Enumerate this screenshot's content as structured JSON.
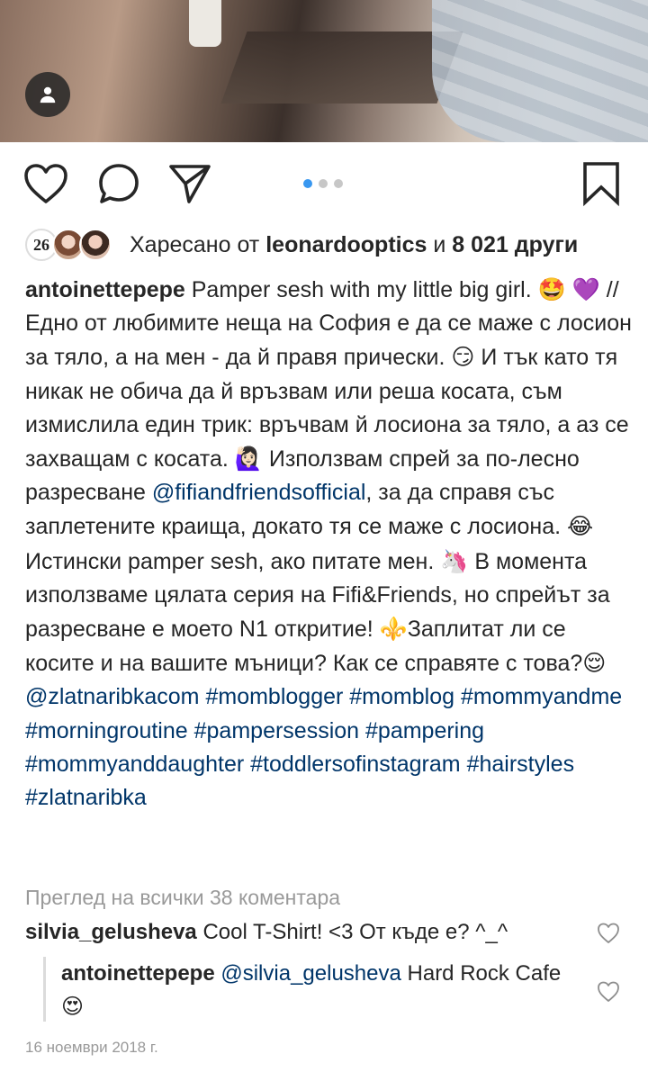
{
  "post": {
    "date": "16 ноември 2018 г.",
    "carousel": {
      "count": 3,
      "active": 0
    }
  },
  "likes": {
    "prefix": "Харесано от",
    "user": "leonardooptics",
    "and": "и",
    "others": "8 021 други",
    "first_avatar_text": "26"
  },
  "caption": {
    "username": "antoinettepepe",
    "parts": [
      {
        "type": "text",
        "value": " Pamper sesh with my little big girl. "
      },
      {
        "type": "emoji",
        "value": "🤩"
      },
      {
        "type": "text",
        "value": " "
      },
      {
        "type": "emoji",
        "value": "💜"
      },
      {
        "type": "text",
        "value": " // Едно от любимите неща на София е да се маже с лосион за тяло, а на мен - да й правя прически. "
      },
      {
        "type": "emoji",
        "value": "😏"
      },
      {
        "type": "text",
        "value": " И тък като тя никак не обича да й връзвам или реша косата, съм измислила един трик: връчвам й лосиона за тяло, а аз се захващам с косата. "
      },
      {
        "type": "emoji",
        "value": "🙋🏻‍♀️"
      },
      {
        "type": "text",
        "value": " Използвам спрей за по-лесно разресване "
      },
      {
        "type": "link",
        "value": "@fifiandfriendsofficial"
      },
      {
        "type": "text",
        "value": ", за да справя със заплетените краища, докато тя се маже с лосиона. "
      },
      {
        "type": "emoji",
        "value": "😂"
      },
      {
        "type": "text",
        "value": " Истински pamper sesh, ако питате мен. "
      },
      {
        "type": "emoji",
        "value": "🦄"
      },
      {
        "type": "text",
        "value": " В момента използваме цялата серия на Fifi&Friends, но спрейът за разресване е моето N1 откритие! "
      },
      {
        "type": "emoji",
        "value": "⚜️"
      },
      {
        "type": "text",
        "value": "Заплитат ли се косите и на вашите мъници? Как се справяте с това?"
      },
      {
        "type": "emoji",
        "value": "😌"
      },
      {
        "type": "text",
        "value": " "
      },
      {
        "type": "link",
        "value": "@zlatnaribkacom"
      },
      {
        "type": "text",
        "value": " "
      },
      {
        "type": "link",
        "value": "#momblogger"
      },
      {
        "type": "text",
        "value": " "
      },
      {
        "type": "link",
        "value": "#momblog"
      },
      {
        "type": "text",
        "value": " "
      },
      {
        "type": "link",
        "value": "#mommyandme"
      },
      {
        "type": "text",
        "value": " "
      },
      {
        "type": "link",
        "value": "#morningroutine"
      },
      {
        "type": "text",
        "value": " "
      },
      {
        "type": "link",
        "value": "#pampersession"
      },
      {
        "type": "text",
        "value": " "
      },
      {
        "type": "link",
        "value": "#pampering"
      },
      {
        "type": "text",
        "value": " "
      },
      {
        "type": "link",
        "value": "#mommyanddaughter"
      },
      {
        "type": "text",
        "value": " "
      },
      {
        "type": "link",
        "value": "#toddlersofinstagram"
      },
      {
        "type": "text",
        "value": " "
      },
      {
        "type": "link",
        "value": "#hairstyles"
      },
      {
        "type": "text",
        "value": " "
      },
      {
        "type": "link",
        "value": "#zlatnaribka"
      }
    ]
  },
  "comments": {
    "view_all": "Преглед на всички 38 коментара",
    "items": [
      {
        "user": "silvia_gelusheva",
        "text": " Cool T-Shirt! <3 От къде е? ^_^"
      }
    ],
    "reply": {
      "user": "antoinettepepe",
      "mention": "@silvia_gelusheva",
      "text": " Hard Rock Cafe ",
      "emoji": "😍"
    }
  },
  "icons": {
    "like": "heart-outline-icon",
    "comment": "speech-bubble-icon",
    "share": "paper-plane-icon",
    "save": "bookmark-icon",
    "user_tag": "person-icon"
  },
  "colors": {
    "link": "#003569",
    "muted": "#999999",
    "carousel_active": "#3897f0",
    "carousel_inactive": "#c7c7c7"
  }
}
